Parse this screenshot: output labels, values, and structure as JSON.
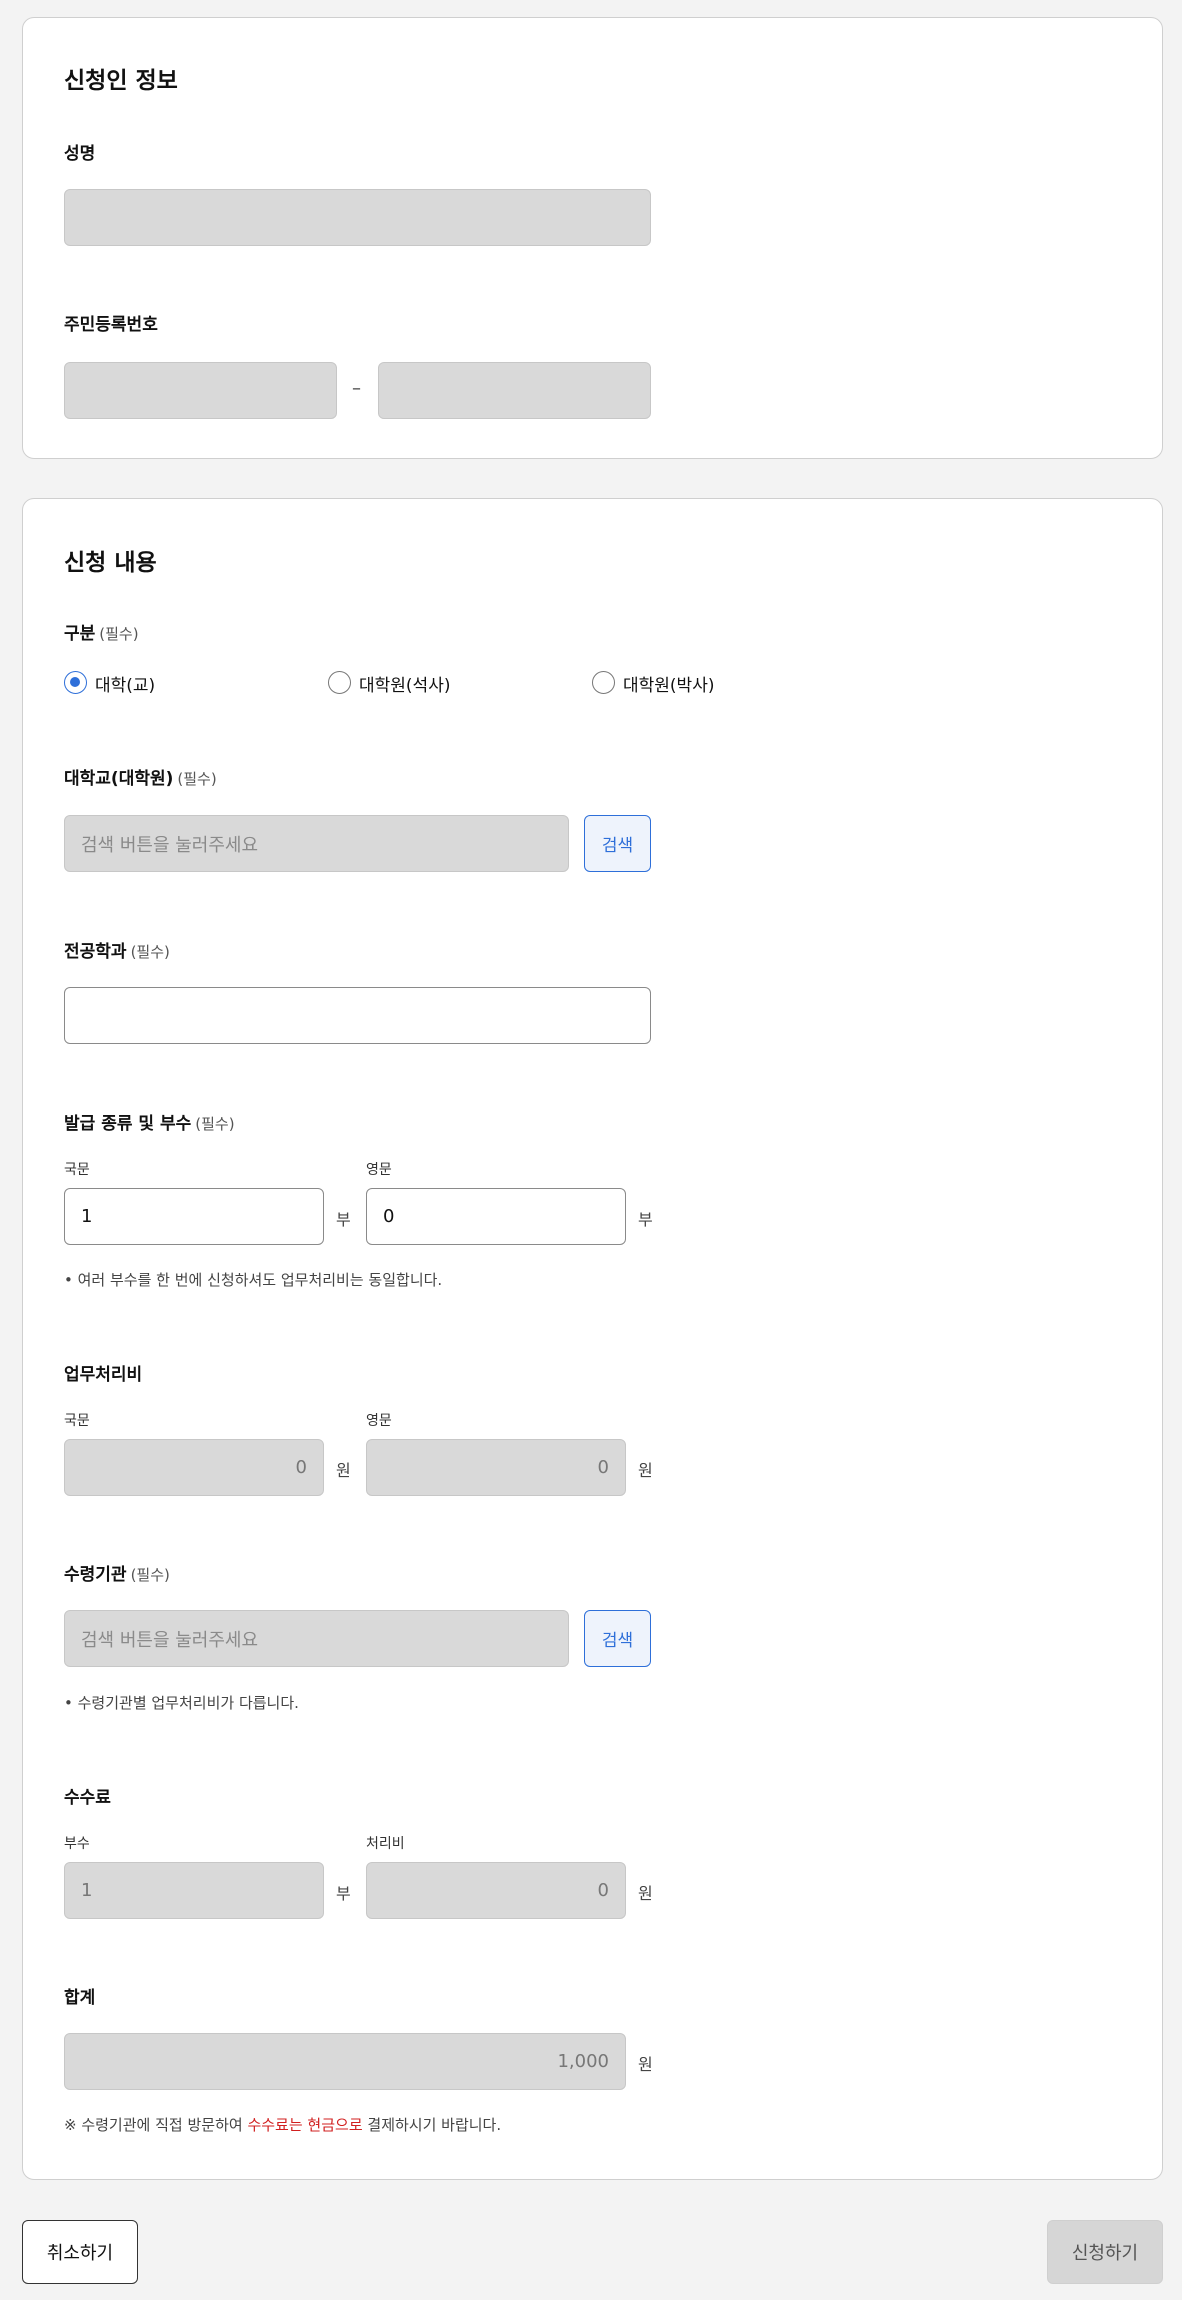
{
  "applicant": {
    "title": "신청인 정보",
    "name_label": "성명",
    "rrn_label": "주민등록번호",
    "rrn_separator": "–"
  },
  "request": {
    "title": "신청 내용",
    "required_mark": "(필수)",
    "category": {
      "label": "구분",
      "options": [
        "대학(교)",
        "대학원(석사)",
        "대학원(박사)"
      ],
      "selected": "대학(교)"
    },
    "university": {
      "label": "대학교(대학원)",
      "placeholder": "검색 버튼을 눌러주세요",
      "search_label": "검색"
    },
    "major": {
      "label": "전공학과",
      "value": ""
    },
    "issue": {
      "label": "발급 종류 및 부수",
      "korean_label": "국문",
      "korean_value": "1",
      "english_label": "영문",
      "english_value": "0",
      "unit": "부",
      "note": "• 여러 부수를 한 번에 신청하셔도 업무처리비는 동일합니다."
    },
    "processing_fee": {
      "label": "업무처리비",
      "korean_label": "국문",
      "korean_value": "0",
      "english_label": "영문",
      "english_value": "0",
      "unit": "원"
    },
    "pickup": {
      "label": "수령기관",
      "placeholder": "검색 버튼을 눌러주세요",
      "search_label": "검색",
      "note": "• 수령기관별 업무처리비가 다릅니다."
    },
    "fee": {
      "label": "수수료",
      "copies_label": "부수",
      "copies_value": "1",
      "copies_unit": "부",
      "handling_label": "처리비",
      "handling_value": "0",
      "handling_unit": "원"
    },
    "total": {
      "label": "합계",
      "value": "1,000",
      "unit": "원",
      "note_prefix": "※ 수령기관에 직접 방문하여 ",
      "note_highlight": "수수료는 현금으로",
      "note_suffix": " 결제하시기 바랍니다."
    }
  },
  "footer": {
    "cancel_label": "취소하기",
    "submit_label": "신청하기"
  },
  "colors": {
    "accent": "#2e6fd9",
    "warning": "#d11f1f",
    "disabled_fill": "#d9d9d9"
  }
}
